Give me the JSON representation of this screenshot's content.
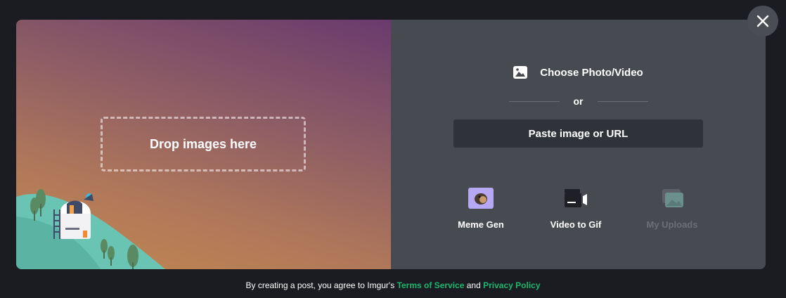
{
  "dropzone": {
    "label": "Drop images here"
  },
  "choose": {
    "label": "Choose Photo/Video",
    "icon": "image-icon"
  },
  "or_text": "or",
  "paste": {
    "label": "Paste image or URL"
  },
  "tools": [
    {
      "label": "Meme Gen",
      "icon": "meme-gen-icon"
    },
    {
      "label": "Video to Gif",
      "icon": "video-camera-icon"
    },
    {
      "label": "My Uploads",
      "icon": "photos-icon"
    }
  ],
  "footer": {
    "prefix": "By creating a post, you agree to Imgur's",
    "terms": "Terms of Service",
    "and": "and",
    "privacy": "Privacy Policy"
  },
  "colors": {
    "accent": "#1bb76e",
    "right_pane": "#474a51",
    "paste_button": "#2f3238",
    "background": "#1b1c21"
  }
}
